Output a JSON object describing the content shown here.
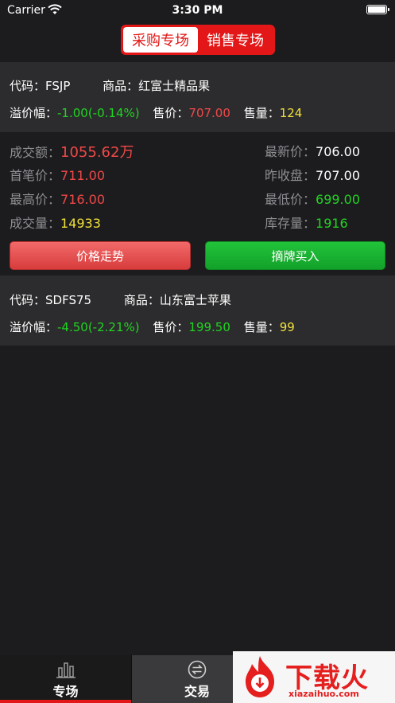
{
  "status_bar": {
    "carrier": "Carrier",
    "time": "3:30 PM"
  },
  "segment": {
    "buy_label": "采购专场",
    "sell_label": "销售专场",
    "active": "buy"
  },
  "products": [
    {
      "code_label": "代码：",
      "code": "FSJP",
      "name_label": "商品：",
      "name": "红富士精品果",
      "premium_label": "溢价幅：",
      "premium": "-1.00(-0.14%)",
      "price_label": "售价：",
      "price": "707.00",
      "volume_label": "售量：",
      "volume": "124"
    },
    {
      "code_label": "代码：",
      "code": "SDFS75",
      "name_label": "商品：",
      "name": "山东富士苹果",
      "premium_label": "溢价幅：",
      "premium": "-4.50(-2.21%)",
      "price_label": "售价：",
      "price": "199.50",
      "volume_label": "售量：",
      "volume": "99"
    }
  ],
  "detail": {
    "turnover_label": "成交额：",
    "turnover": "1055.62万",
    "latest_label": "最新价：",
    "latest": "706.00",
    "first_label": "首笔价：",
    "first": "711.00",
    "prev_close_label": "昨收盘：",
    "prev_close": "707.00",
    "high_label": "最高价：",
    "high": "716.00",
    "low_label": "最低价：",
    "low": "699.00",
    "deal_volume_label": "成交量：",
    "deal_volume": "14933",
    "stock_label": "库存量：",
    "stock": "1916",
    "trend_button": "价格走势",
    "buy_button": "摘牌买入"
  },
  "tabbar": {
    "home_label": "专场",
    "trade_label": "交易"
  },
  "watermark": {
    "text": "下载火",
    "url": "xiazaihuo.com"
  },
  "colors": {
    "accent_red": "#e31717",
    "up_green": "#21d321",
    "down_red": "#f04848",
    "highlight_yellow": "#f0e03a"
  }
}
